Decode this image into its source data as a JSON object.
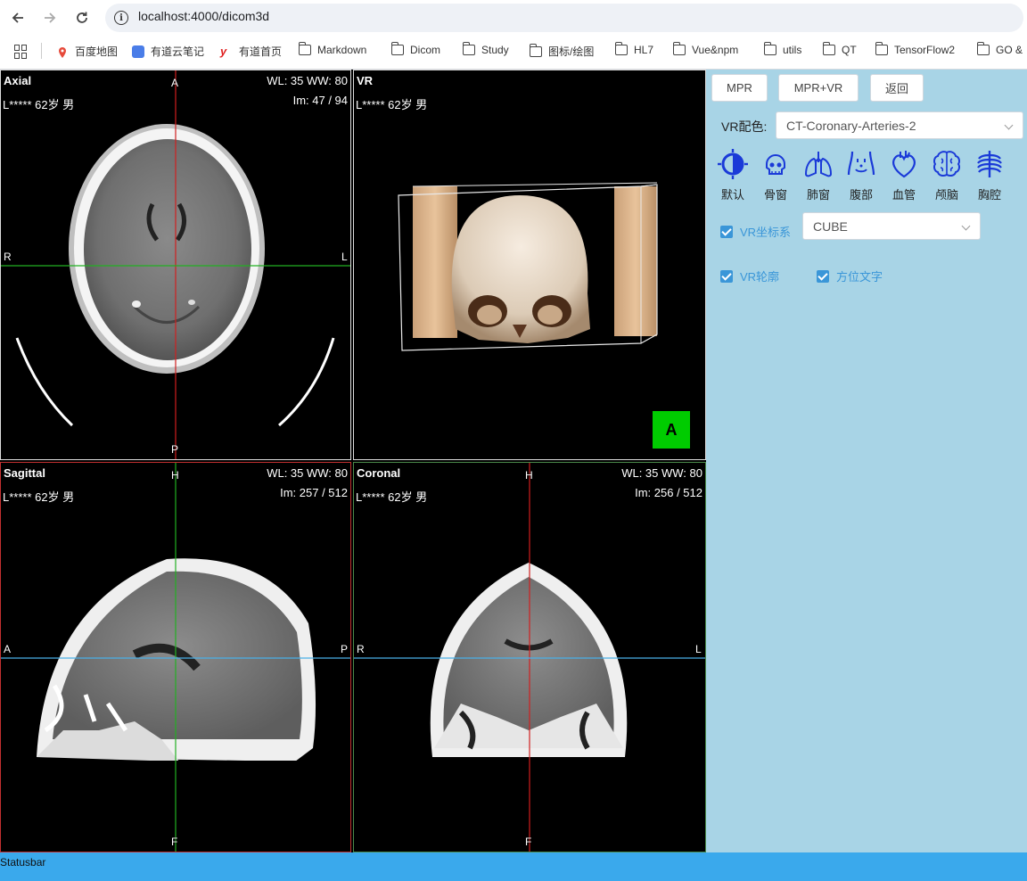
{
  "browser": {
    "url": "localhost:4000/dicom3d",
    "bookmarks": [
      {
        "label": "百度地图",
        "icon": "map-pin-icon"
      },
      {
        "label": "有道云笔记",
        "icon": "note-app-icon"
      },
      {
        "label": "有道首页",
        "icon": "youdao-y-icon"
      },
      {
        "label": "Markdown",
        "icon": "folder-icon"
      },
      {
        "label": "Dicom",
        "icon": "folder-icon"
      },
      {
        "label": "Study",
        "icon": "folder-icon"
      },
      {
        "label": "图标/绘图",
        "icon": "folder-icon"
      },
      {
        "label": "HL7",
        "icon": "folder-icon"
      },
      {
        "label": "Vue&npm",
        "icon": "folder-icon"
      },
      {
        "label": "utils",
        "icon": "folder-icon"
      },
      {
        "label": "QT",
        "icon": "folder-icon"
      },
      {
        "label": "TensorFlow2",
        "icon": "folder-icon"
      },
      {
        "label": "GO &",
        "icon": "folder-icon"
      }
    ]
  },
  "viewports": {
    "axial": {
      "title": "Axial",
      "patient": "L***** 62岁 男",
      "wl": "WL: 35 WW: 80",
      "im": "Im: 47 / 94",
      "top": "A",
      "bottom": "P",
      "left": "R",
      "right": "L"
    },
    "vr": {
      "title": "VR",
      "patient": "L***** 62岁 男",
      "cube_face": "A"
    },
    "sagittal": {
      "title": "Sagittal",
      "patient": "L***** 62岁 男",
      "wl": "WL: 35 WW: 80",
      "im": "Im: 257 / 512",
      "top": "H",
      "bottom": "F",
      "left": "A",
      "right": "P"
    },
    "coronal": {
      "title": "Coronal",
      "patient": "L***** 62岁 男",
      "wl": "WL: 35 WW: 80",
      "im": "Im: 256 / 512",
      "top": "H",
      "bottom": "F",
      "left": "R",
      "right": "L"
    }
  },
  "panel": {
    "buttons": {
      "mpr": "MPR",
      "mpr_vr": "MPR+VR",
      "back": "返回"
    },
    "vr_color_label": "VR配色:",
    "vr_color_value": "CT-Coronary-Arteries-2",
    "presets": [
      {
        "label": "默认",
        "icon": "contrast-icon"
      },
      {
        "label": "骨窗",
        "icon": "skull-icon"
      },
      {
        "label": "肺窗",
        "icon": "lungs-icon"
      },
      {
        "label": "腹部",
        "icon": "abdomen-icon"
      },
      {
        "label": "血管",
        "icon": "heart-icon"
      },
      {
        "label": "颅脑",
        "icon": "brain-icon"
      },
      {
        "label": "胸腔",
        "icon": "ribcage-icon"
      }
    ],
    "vr_axes_label": "VR坐标系",
    "vr_axes_checked": true,
    "vr_axes_value": "CUBE",
    "vr_outline_label": "VR轮廓",
    "vr_outline_checked": true,
    "orient_text_label": "方位文字",
    "orient_text_checked": true
  },
  "statusbar": {
    "text": "Statusbar"
  },
  "colors": {
    "panel_bg": "#a8d4e6",
    "statusbar_bg": "#3aa9ec",
    "accent": "#3a96d8",
    "preset_icon": "#1a3ad8",
    "cube_face": "#00cc00"
  }
}
